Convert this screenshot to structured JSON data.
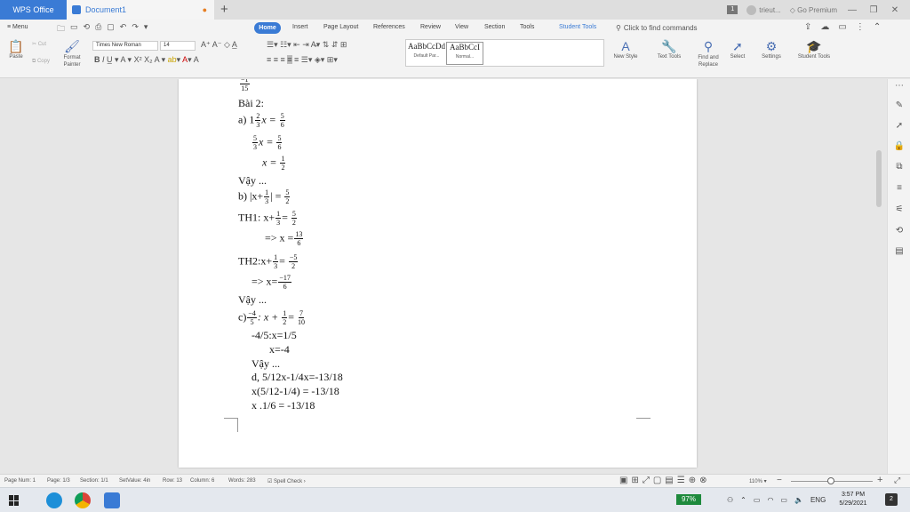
{
  "titlebar": {
    "app_tab": "WPS Office",
    "doc_tab": "Document1",
    "new_tab": "+",
    "badge": "1",
    "user": "trieut...",
    "premium": "Go Premium",
    "min": "—",
    "restore": "❐",
    "close": "✕"
  },
  "menubar": {
    "menu": "≡ Menu",
    "tabs": [
      "Home",
      "Insert",
      "Page Layout",
      "References",
      "Review",
      "View",
      "Section",
      "Tools",
      "Student Tools"
    ],
    "search": "Click to find commands"
  },
  "ribbon": {
    "paste": "Paste",
    "cut": "Cut",
    "copy": "Copy",
    "format_painter": [
      "Format",
      "Painter"
    ],
    "font_name": "Times New Roman",
    "font_size": "14",
    "styles": [
      {
        "preview": "AaBbCcDd",
        "caption": "Default Par..."
      },
      {
        "preview": "AaBbCcI",
        "caption": "Normal..."
      }
    ],
    "new_style": "New Style",
    "text_tools": "Text Tools",
    "find_replace": [
      "Find and",
      "Replace"
    ],
    "select": "Select",
    "settings": "Settings",
    "student_tools": "Student Tools"
  },
  "document": {
    "lines": {
      "l0_num": "−1",
      "l0_den": "15",
      "bai2": "Bài 2:",
      "a_prefix": "a) 1",
      "a_m_num": "2",
      "a_m_den": "3",
      "a_x_eq": "x =",
      "a_r_num": "5",
      "a_r_den": "6",
      "a2_l_num": "5",
      "a2_l_den": "3",
      "a2_x_eq": "x =",
      "a2_r_num": "5",
      "a2_r_den": "6",
      "a3_x_eq": "x =",
      "a3_r_num": "1",
      "a3_r_den": "2",
      "vay1": "Vậy ...",
      "b_prefix": "b) |x+",
      "b_m_num": "1",
      "b_m_den": "3",
      "b_eq": "| =",
      "b_r_num": "5",
      "b_r_den": "2",
      "th1_prefix": "TH1: x+",
      "th1_m_num": "1",
      "th1_m_den": "3",
      "th1_eq": "=",
      "th1_r_num": "5",
      "th1_r_den": "2",
      "th1b_prefix": "=>   x =",
      "th1b_num": "13",
      "th1b_den": "6",
      "th2_prefix": "TH2:x+",
      "th2_m_num": "1",
      "th2_m_den": "3",
      "th2_eq": "=",
      "th2_r_num": "−5",
      "th2_r_den": "2",
      "th2b_prefix": "=> x=",
      "th2b_num": "−17",
      "th2b_den": "6",
      "vay2": "Vậy ...",
      "c_prefix": "c)",
      "c_l_num": "−4",
      "c_l_den": "5",
      "c_mid": ": x +",
      "c_m_num": "1",
      "c_m_den": "2",
      "c_eq": "=",
      "c_r_num": "7",
      "c_r_den": "10",
      "c2": "-4/5:x=1/5",
      "c3": "x=-4",
      "vay3": "Vậy ...",
      "d1": "d, 5/12x-1/4x=-13/18",
      "d2": "x(5/12-1/4)  = -13/18",
      "d3": "x .1/6          = -13/18"
    }
  },
  "statusbar": {
    "page_num": "Page Num: 1",
    "page": "Page: 1/3",
    "section": "Section: 1/1",
    "set_value": "SetValue: 4in",
    "row": "Row: 13",
    "column": "Column: 6",
    "words": "Words: 283",
    "spell": "Spell Check",
    "zoom": "110%"
  },
  "taskbar": {
    "battery": "97%",
    "lang": "ENG",
    "time": "3:57 PM",
    "date": "5/29/2021",
    "notif": "2"
  },
  "colors": {
    "accent": "#3a7bd5",
    "battery": "#1e8a3c"
  }
}
